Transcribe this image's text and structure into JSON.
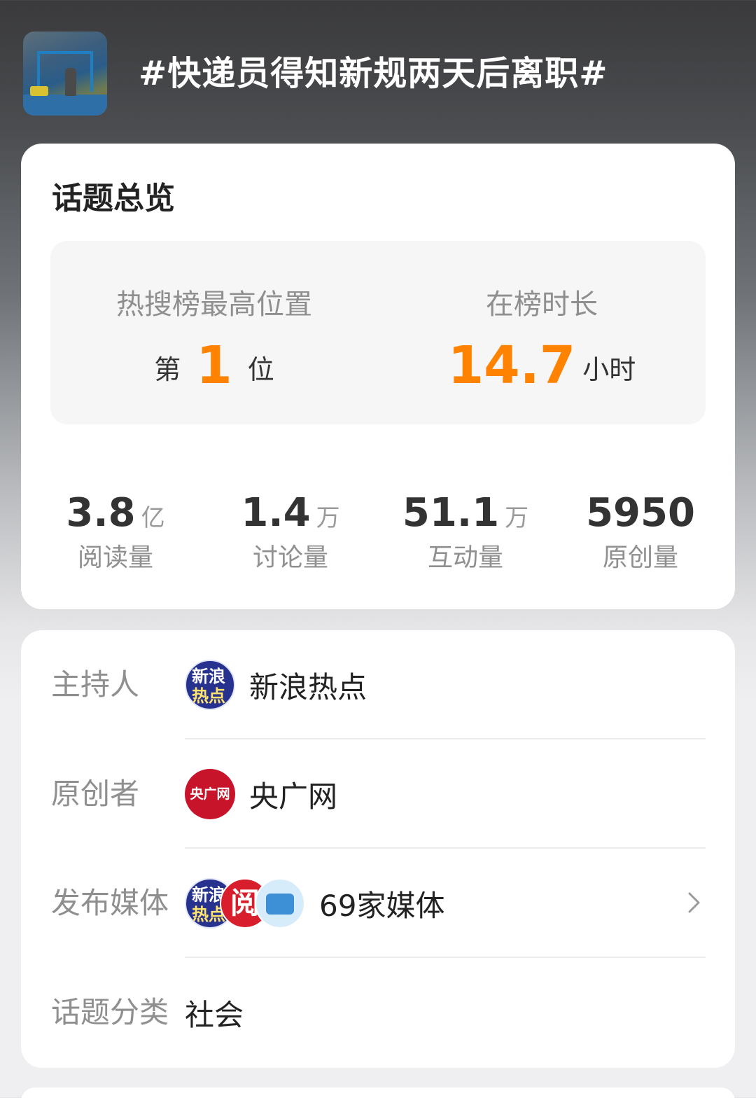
{
  "header": {
    "topic_title": "#快递员得知新规两天后离职#",
    "thumbnail_icon": "topic-photo"
  },
  "overview": {
    "section_title": "话题总览",
    "rank": {
      "label": "热搜榜最高位置",
      "prefix": "第",
      "value": "1",
      "suffix": "位"
    },
    "duration": {
      "label": "在榜时长",
      "value": "14.7",
      "unit": "小时"
    },
    "stats": [
      {
        "value": "3.8",
        "unit": "亿",
        "label": "阅读量"
      },
      {
        "value": "1.4",
        "unit": "万",
        "label": "讨论量"
      },
      {
        "value": "51.1",
        "unit": "万",
        "label": "互动量"
      },
      {
        "value": "5950",
        "unit": "",
        "label": "原创量"
      }
    ],
    "accent_color": "#ff8200"
  },
  "info": {
    "host": {
      "label": "主持人",
      "name": "新浪热点",
      "avatar_text_1": "新浪",
      "avatar_text_2": "热点"
    },
    "creator": {
      "label": "原创者",
      "name": "央广网",
      "avatar_text": "央广网"
    },
    "media": {
      "label": "发布媒体",
      "count_text": "69家媒体",
      "avatar_red_text": "阅"
    },
    "category": {
      "label": "话题分类",
      "value": "社会"
    }
  }
}
